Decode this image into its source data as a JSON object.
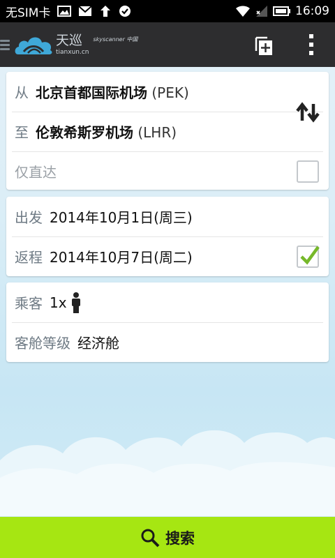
{
  "status_bar": {
    "carrier": "无SIM卡",
    "time": "16:09",
    "icons_left": [
      "image-icon",
      "mail-icon",
      "upload-icon",
      "check-circle-icon"
    ],
    "icons_right": [
      "wifi-icon",
      "signal-icon",
      "battery-icon"
    ]
  },
  "action_bar": {
    "logo_cn": "天巡",
    "logo_sub": "tianxun.cn",
    "logo_brand": "skyscanner 中国",
    "actions": [
      "copy-add-icon",
      "overflow-menu-icon"
    ]
  },
  "route": {
    "from_label": "从",
    "from_name": "北京首都国际机场",
    "from_code": "(PEK)",
    "to_label": "至",
    "to_name": "伦敦希斯罗机场",
    "to_code": "(LHR)",
    "direct_label": "仅直达",
    "direct_checked": false
  },
  "dates": {
    "depart_label": "出发",
    "depart_value": "2014年10月1日(周三)",
    "return_label": "返程",
    "return_value": "2014年10月7日(周二)",
    "return_checked": true
  },
  "passengers": {
    "passenger_label": "乘客",
    "passenger_count": "1x",
    "class_label": "客舱等级",
    "class_value": "经济舱"
  },
  "search": {
    "label": "搜索"
  },
  "colors": {
    "accent_green": "#a6e612",
    "check_green": "#76b82a",
    "actionbar_bg": "#2d2d2f"
  }
}
